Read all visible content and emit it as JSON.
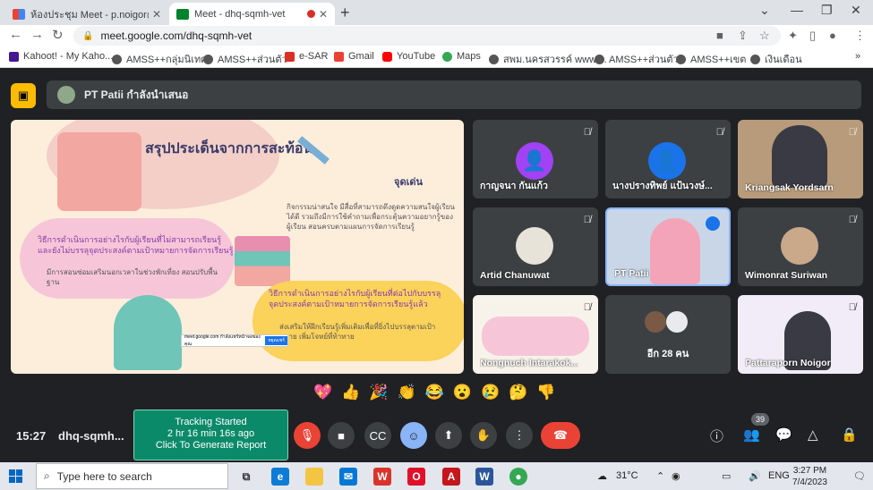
{
  "browser": {
    "tabs": [
      {
        "title": "ห้องประชุม Meet - p.noigor@gmai",
        "active": false
      },
      {
        "title": "Meet - dhq-sqmh-vet",
        "active": true
      }
    ],
    "url": "meet.google.com/dhq-sqmh-vet",
    "bookmarks": [
      {
        "label": "Kahoot! - My Kaho...",
        "color": "#46178f"
      },
      {
        "label": "AMSS++กลุ่มนิเทศ",
        "color": "#444"
      },
      {
        "label": "AMSS++ส่วนตัว",
        "color": "#444"
      },
      {
        "label": "e-SAR",
        "color": "#d93025"
      },
      {
        "label": "Gmail",
        "color": "#ea4335"
      },
      {
        "label": "YouTube",
        "color": "#ff0000"
      },
      {
        "label": "Maps",
        "color": "#34a853"
      },
      {
        "label": "สพม.นครสวรรค์ www....",
        "color": "#444"
      },
      {
        "label": "AMSS++ส่วนตัว",
        "color": "#444"
      },
      {
        "label": "AMSS++เขต",
        "color": "#444"
      },
      {
        "label": "เงินเดือน",
        "color": "#444"
      }
    ]
  },
  "meet": {
    "presenter_label": "PT Patii กำลังนำเสนอ",
    "slide": {
      "heading": "สรุปประเด็นจากการสะท้อน",
      "strengths_title": "จุดเด่น",
      "strengths_text": "กิจกรรมน่าสนใจ  มีสื่อที่สามารถดึงดูดความสนใจผู้เรียนได้ดี  รวมถึงมีการใช้คำถามเพื่อกระตุ้นความอยากรู้ของผู้เรียน  สอนครบตามแผนการจัดการเรียนรู้",
      "left_title": "วิธีการดำเนินการอย่างไรกับผู้เรียนที่ไม่สามารถเรียนรู้และยังไม่บรรลุจุดประสงค์ตามเป้าหมายการจัดการเรียนรู้",
      "left_text": "มีการสอนซ่อมเสริมนอกเวลาในช่วงพักเที่ยง  สอนปรับพื้นฐาน",
      "right_title": "วิธีการดำเนินการอย่างไรกับผู้เรียนที่ต่อไปกับบรรลุจุดประสงค์ตามเป้าหมายการจัดการเรียนรู้แล้ว",
      "right_text": "ส่งเสริมให้ฝึกเรียนรู้เพิ่มเติมเพื่อที่ยิ่งไปบรรลุตามเป้าหมาย  เพิ่มโจทย์ที่ท้าทาย",
      "mini_bar": "meet.google.com กำลังแชร์หน้าจอของคุณ",
      "mini_btn": "หยุดแชร์"
    },
    "participants": [
      {
        "name": "กาญจนา กันแก้ว",
        "kind": "avatar",
        "color": "#a142f4"
      },
      {
        "name": "นางปรางทิพย์ แป้นวงษ์...",
        "kind": "avatar",
        "color": "#1a73e8"
      },
      {
        "name": "Kriangsak Yordsarn",
        "kind": "video"
      },
      {
        "name": "Artid Chanuwat",
        "kind": "photo"
      },
      {
        "name": "PT Patii",
        "kind": "video"
      },
      {
        "name": "Wimonrat Suriwan",
        "kind": "photo"
      },
      {
        "name": "Nongnuch Intarakok...",
        "kind": "video"
      },
      {
        "name": "อีก 28 คน",
        "kind": "more"
      },
      {
        "name": "Pattaraporn Noigor",
        "kind": "video"
      }
    ],
    "reactions": [
      "💖",
      "👍",
      "🎉",
      "👏",
      "😂",
      "😮",
      "😢",
      "🤔",
      "👎"
    ],
    "time": "15:27",
    "meeting_code": "dhq-sqmh...",
    "participant_count": "39"
  },
  "tracking": {
    "line1": "Tracking Started",
    "line2": "2 hr 16 min 16s ago",
    "line3": "Click To Generate Report"
  },
  "taskbar": {
    "search_placeholder": "Type here to search",
    "weather": "31°C",
    "lang": "ENG",
    "time": "3:27 PM",
    "date": "7/4/2023"
  }
}
